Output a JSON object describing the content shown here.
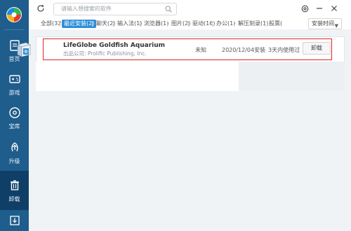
{
  "search": {
    "placeholder": "请输入想搜索的软件"
  },
  "sidebar": {
    "items": [
      {
        "label": "首页",
        "icon": "home-icon"
      },
      {
        "label": "游戏",
        "icon": "gamepad-icon"
      },
      {
        "label": "宝库",
        "icon": "treasure-disc-icon"
      },
      {
        "label": "升级",
        "icon": "upgrade-icon"
      },
      {
        "label": "卸载",
        "icon": "trash-icon",
        "active": true
      },
      {
        "label": "",
        "icon": "download-icon"
      }
    ]
  },
  "tabs": [
    {
      "label": "全部(32)"
    },
    {
      "label": "最近安装(2)",
      "active": true
    },
    {
      "label": "聊天(2)"
    },
    {
      "label": "输入法(1)"
    },
    {
      "label": "浏览器(1)"
    },
    {
      "label": "图片(2)"
    },
    {
      "label": "驱动(16)"
    },
    {
      "label": "办公(1)"
    },
    {
      "label": "解压刻录(1)"
    },
    {
      "label": "股票("
    }
  ],
  "sort": {
    "label": "安装时间"
  },
  "colors": {
    "sidebar": "#1e5d8c",
    "sidebar_active": "#0f3f66",
    "accent": "#2d8ed9",
    "highlight": "#e02424"
  },
  "software": [
    {
      "name": "LifeGlobe Goldfish Aquarium",
      "publisher": "出品公司: Prolific Publishing, Inc.",
      "size": "未知",
      "install_date": "2020/12/04安装",
      "usage": "3天内使用过",
      "action": "卸载"
    }
  ]
}
